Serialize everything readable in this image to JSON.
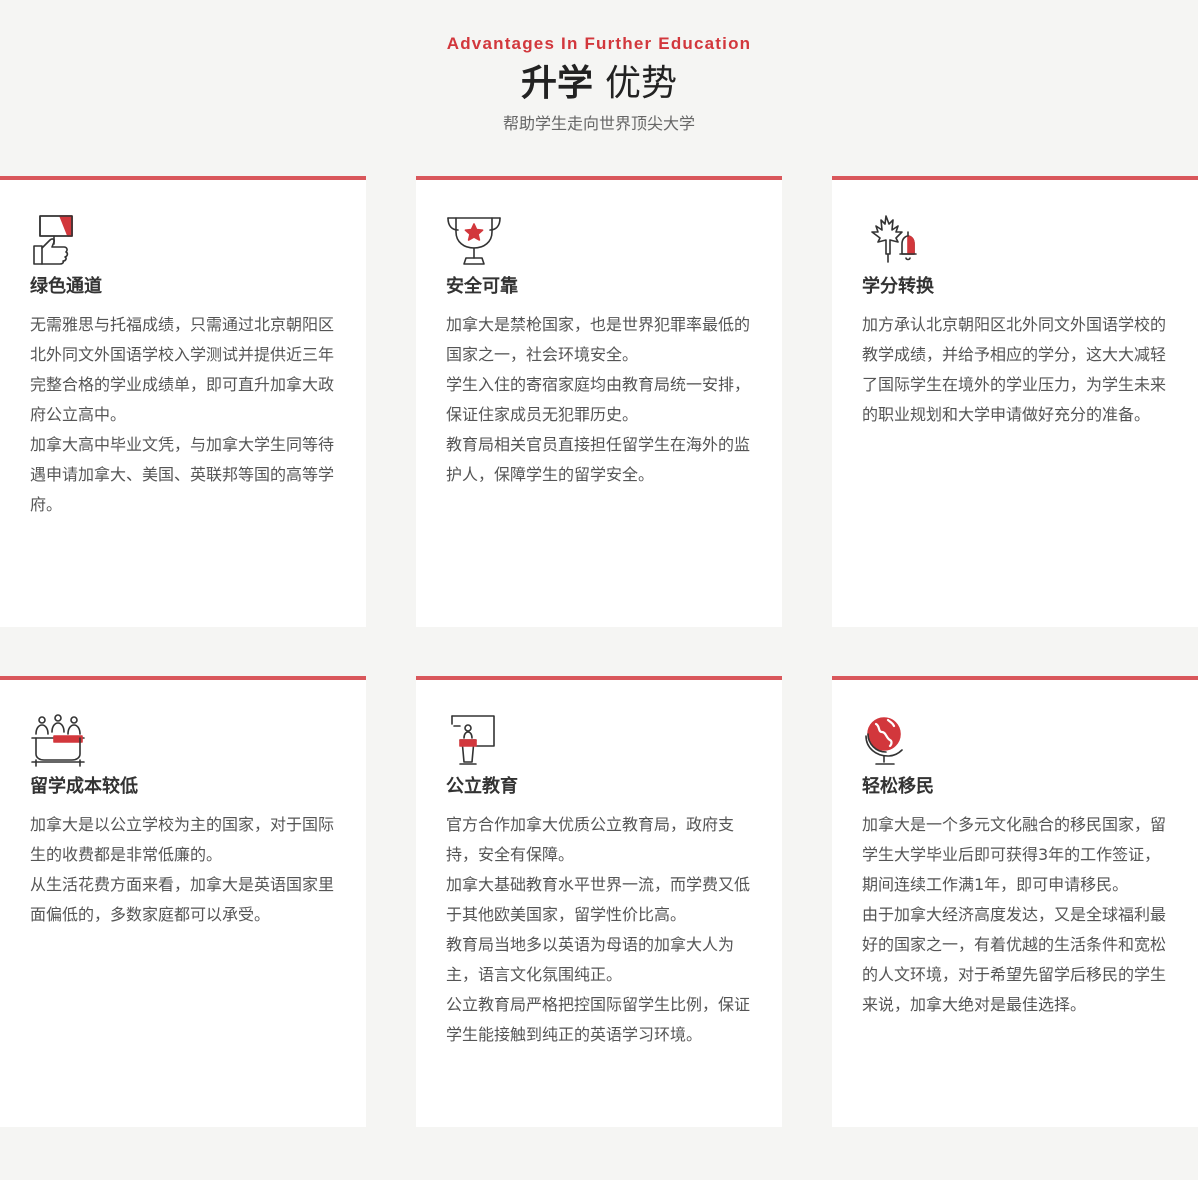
{
  "header": {
    "eyebrow": "Advantages In Further Education",
    "title_bold": "升学",
    "title_light": "优势",
    "subtitle": "帮助学生走向世界顶尖大学"
  },
  "colors": {
    "accent": "#d2373c",
    "card_border": "#d9575b",
    "background": "#f5f5f3",
    "card_background": "#ffffff",
    "icon_stroke": "#333333"
  },
  "cards": [
    {
      "icon": "thumbs-up-sign-icon",
      "title": "绿色通道",
      "paragraphs": [
        "无需雅思与托福成绩，只需通过北京朝阳区北外同文外国语学校入学测试并提供近三年完整合格的学业成绩单，即可直升加拿大政府公立高中。",
        "加拿大高中毕业文凭，与加拿大学生同等待遇申请加拿大、美国、英联邦等国的高等学府。"
      ]
    },
    {
      "icon": "trophy-star-icon",
      "title": "安全可靠",
      "paragraphs": [
        "加拿大是禁枪国家，也是世界犯罪率最低的国家之一，社会环境安全。",
        "学生入住的寄宿家庭均由教育局统一安排，保证住家成员无犯罪历史。",
        "教育局相关官员直接担任留学生在海外的监护人，保障学生的留学安全。"
      ]
    },
    {
      "icon": "maple-leaf-bell-icon",
      "title": "学分转换",
      "paragraphs": [
        "加方承认北京朝阳区北外同文外国语学校的教学成绩，并给予相应的学分，这大大减轻了国际学生在境外的学业压力，为学生未来的职业规划和大学申请做好充分的准备。"
      ]
    },
    {
      "icon": "meeting-table-people-icon",
      "title": "留学成本较低",
      "paragraphs": [
        "加拿大是以公立学校为主的国家，对于国际生的收费都是非常低廉的。",
        "从生活花费方面来看，加拿大是英语国家里面偏低的，多数家庭都可以承受。"
      ]
    },
    {
      "icon": "lecture-podium-icon",
      "title": "公立教育",
      "paragraphs": [
        "官方合作加拿大优质公立教育局，政府支持，安全有保障。",
        "加拿大基础教育水平世界一流，而学费又低于其他欧美国家，留学性价比高。",
        "教育局当地多以英语为母语的加拿大人为主，语言文化氛围纯正。",
        "公立教育局严格把控国际留学生比例，保证学生能接触到纯正的英语学习环境。"
      ]
    },
    {
      "icon": "globe-icon",
      "title": "轻松移民",
      "paragraphs": [
        "加拿大是一个多元文化融合的移民国家，留学生大学毕业后即可获得3年的工作签证，期间连续工作满1年，即可申请移民。",
        "由于加拿大经济高度发达，又是全球福利最好的国家之一，有着优越的生活条件和宽松的人文环境，对于希望先留学后移民的学生来说，加拿大绝对是最佳选择。"
      ]
    }
  ]
}
